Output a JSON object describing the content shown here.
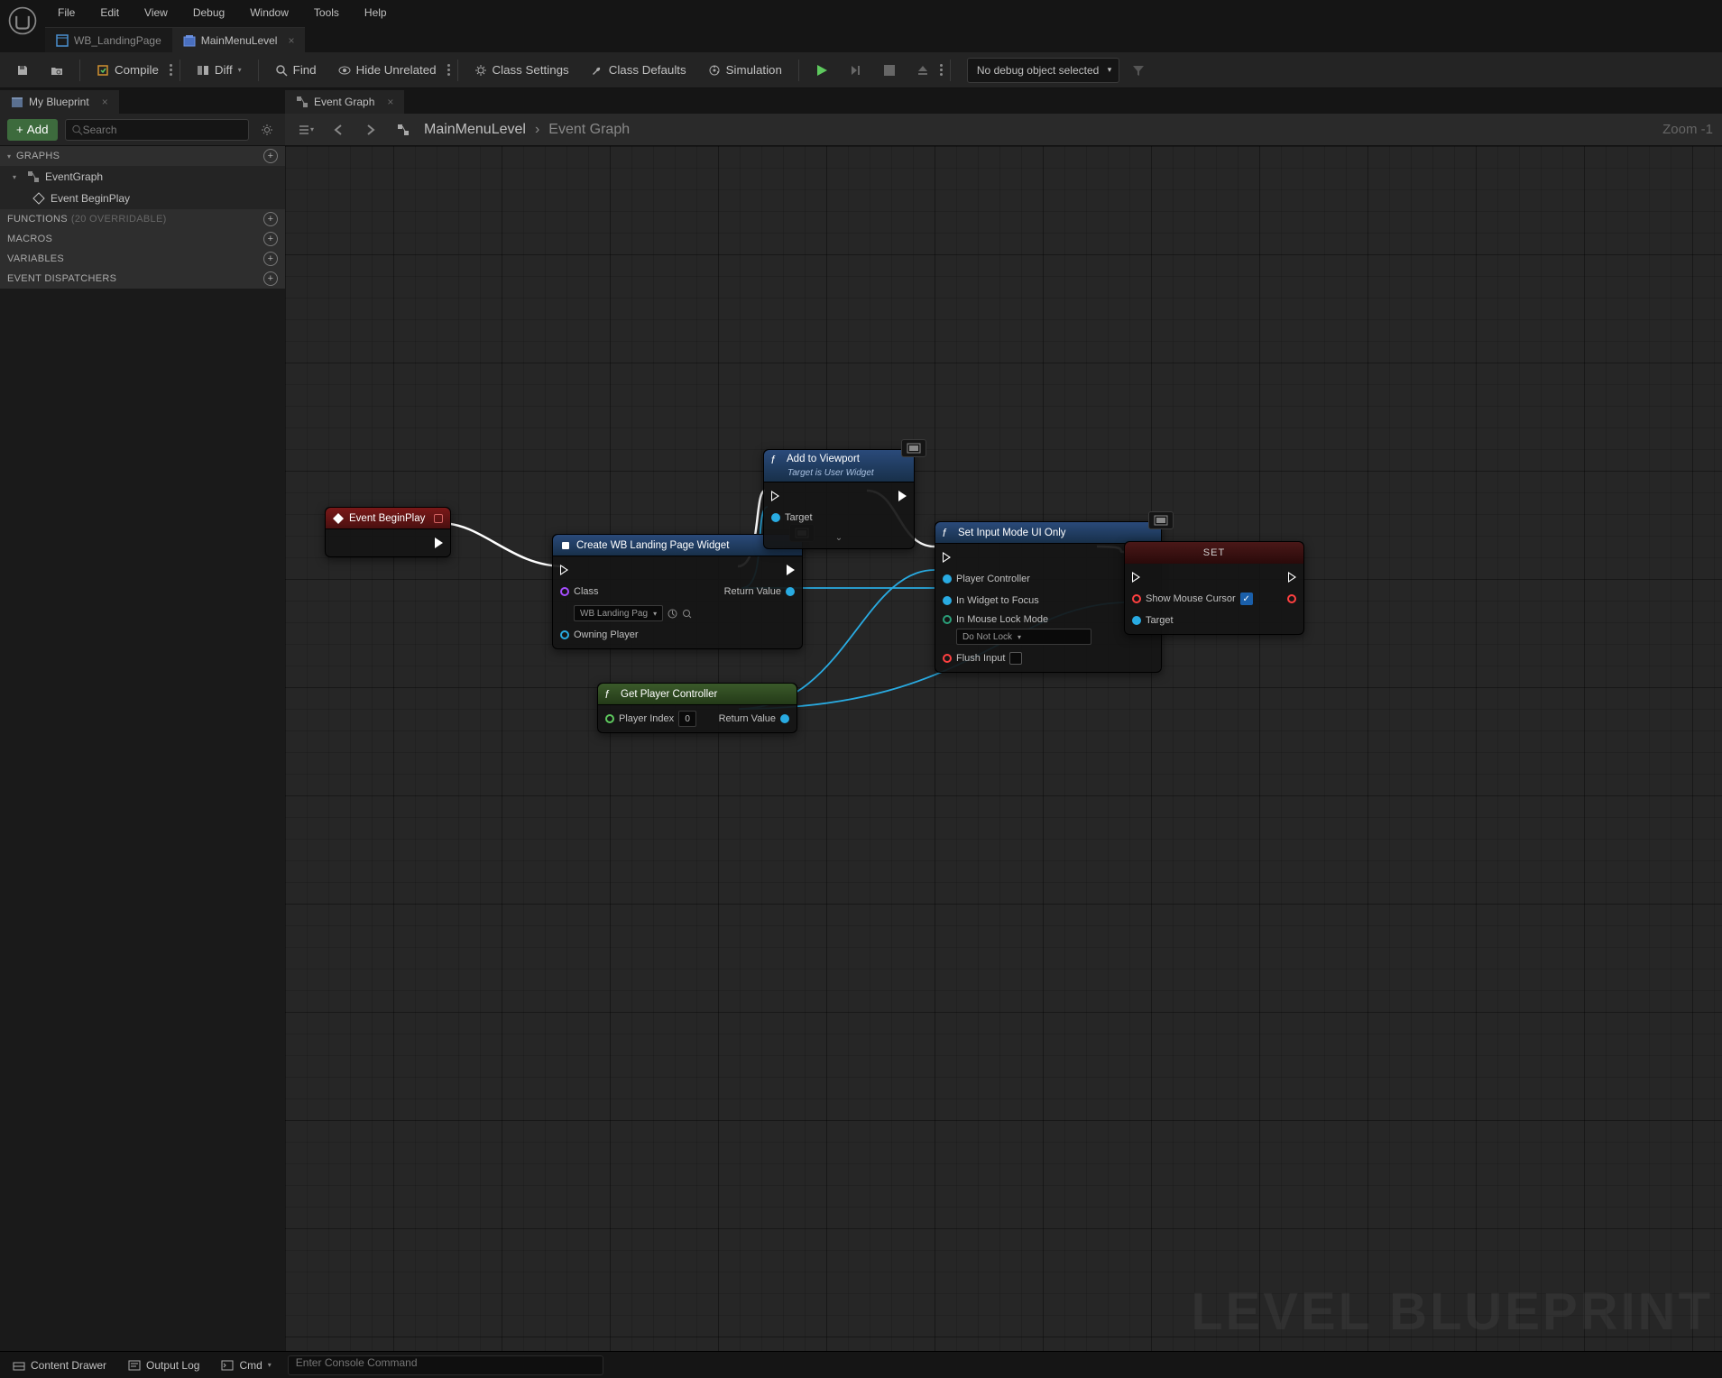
{
  "menu": {
    "file": "File",
    "edit": "Edit",
    "view": "View",
    "debug": "Debug",
    "window": "Window",
    "tools": "Tools",
    "help": "Help"
  },
  "asset_tabs": {
    "tab1": {
      "label": "WB_LandingPage"
    },
    "tab2": {
      "label": "MainMenuLevel"
    }
  },
  "toolbar": {
    "compile": "Compile",
    "diff": "Diff",
    "find": "Find",
    "hide_unrelated": "Hide Unrelated",
    "class_settings": "Class Settings",
    "class_defaults": "Class Defaults",
    "simulation": "Simulation",
    "debug_selected": "No debug object selected"
  },
  "sidebar": {
    "panel_title": "My Blueprint",
    "add": "Add",
    "search_placeholder": "Search",
    "sections": {
      "graphs": "GRAPHS",
      "functions": "FUNCTIONS",
      "functions_count": "(20 OVERRIDABLE)",
      "macros": "MACROS",
      "variables": "VARIABLES",
      "dispatchers": "EVENT DISPATCHERS"
    },
    "items": {
      "eventgraph": "EventGraph",
      "begin_play": "Event BeginPlay"
    }
  },
  "graph": {
    "tab_label": "Event Graph",
    "breadcrumb_root": "MainMenuLevel",
    "breadcrumb_current": "Event Graph",
    "zoom": "Zoom -1",
    "watermark": "LEVEL BLUEPRINT"
  },
  "nodes": {
    "begin_play": {
      "title": "Event BeginPlay"
    },
    "create_widget": {
      "title": "Create WB Landing Page Widget",
      "class_label": "Class",
      "class_value": "WB Landing Pag",
      "owning_player": "Owning Player",
      "return_value": "Return Value"
    },
    "add_viewport": {
      "title": "Add to Viewport",
      "subtitle": "Target is User Widget",
      "target": "Target"
    },
    "get_player_controller": {
      "title": "Get Player Controller",
      "player_index_label": "Player Index",
      "player_index_value": "0",
      "return_value": "Return Value"
    },
    "set_input_mode": {
      "title": "Set Input Mode UI Only",
      "player_controller": "Player Controller",
      "widget_to_focus": "In Widget to Focus",
      "mouse_lock": "In Mouse Lock Mode",
      "mouse_lock_value": "Do Not Lock",
      "flush_input": "Flush Input"
    },
    "set_var": {
      "title": "SET",
      "show_mouse_cursor": "Show Mouse Cursor",
      "target": "Target"
    }
  },
  "bottombar": {
    "content_drawer": "Content Drawer",
    "output_log": "Output Log",
    "cmd_label": "Cmd",
    "cmd_placeholder": "Enter Console Command"
  }
}
